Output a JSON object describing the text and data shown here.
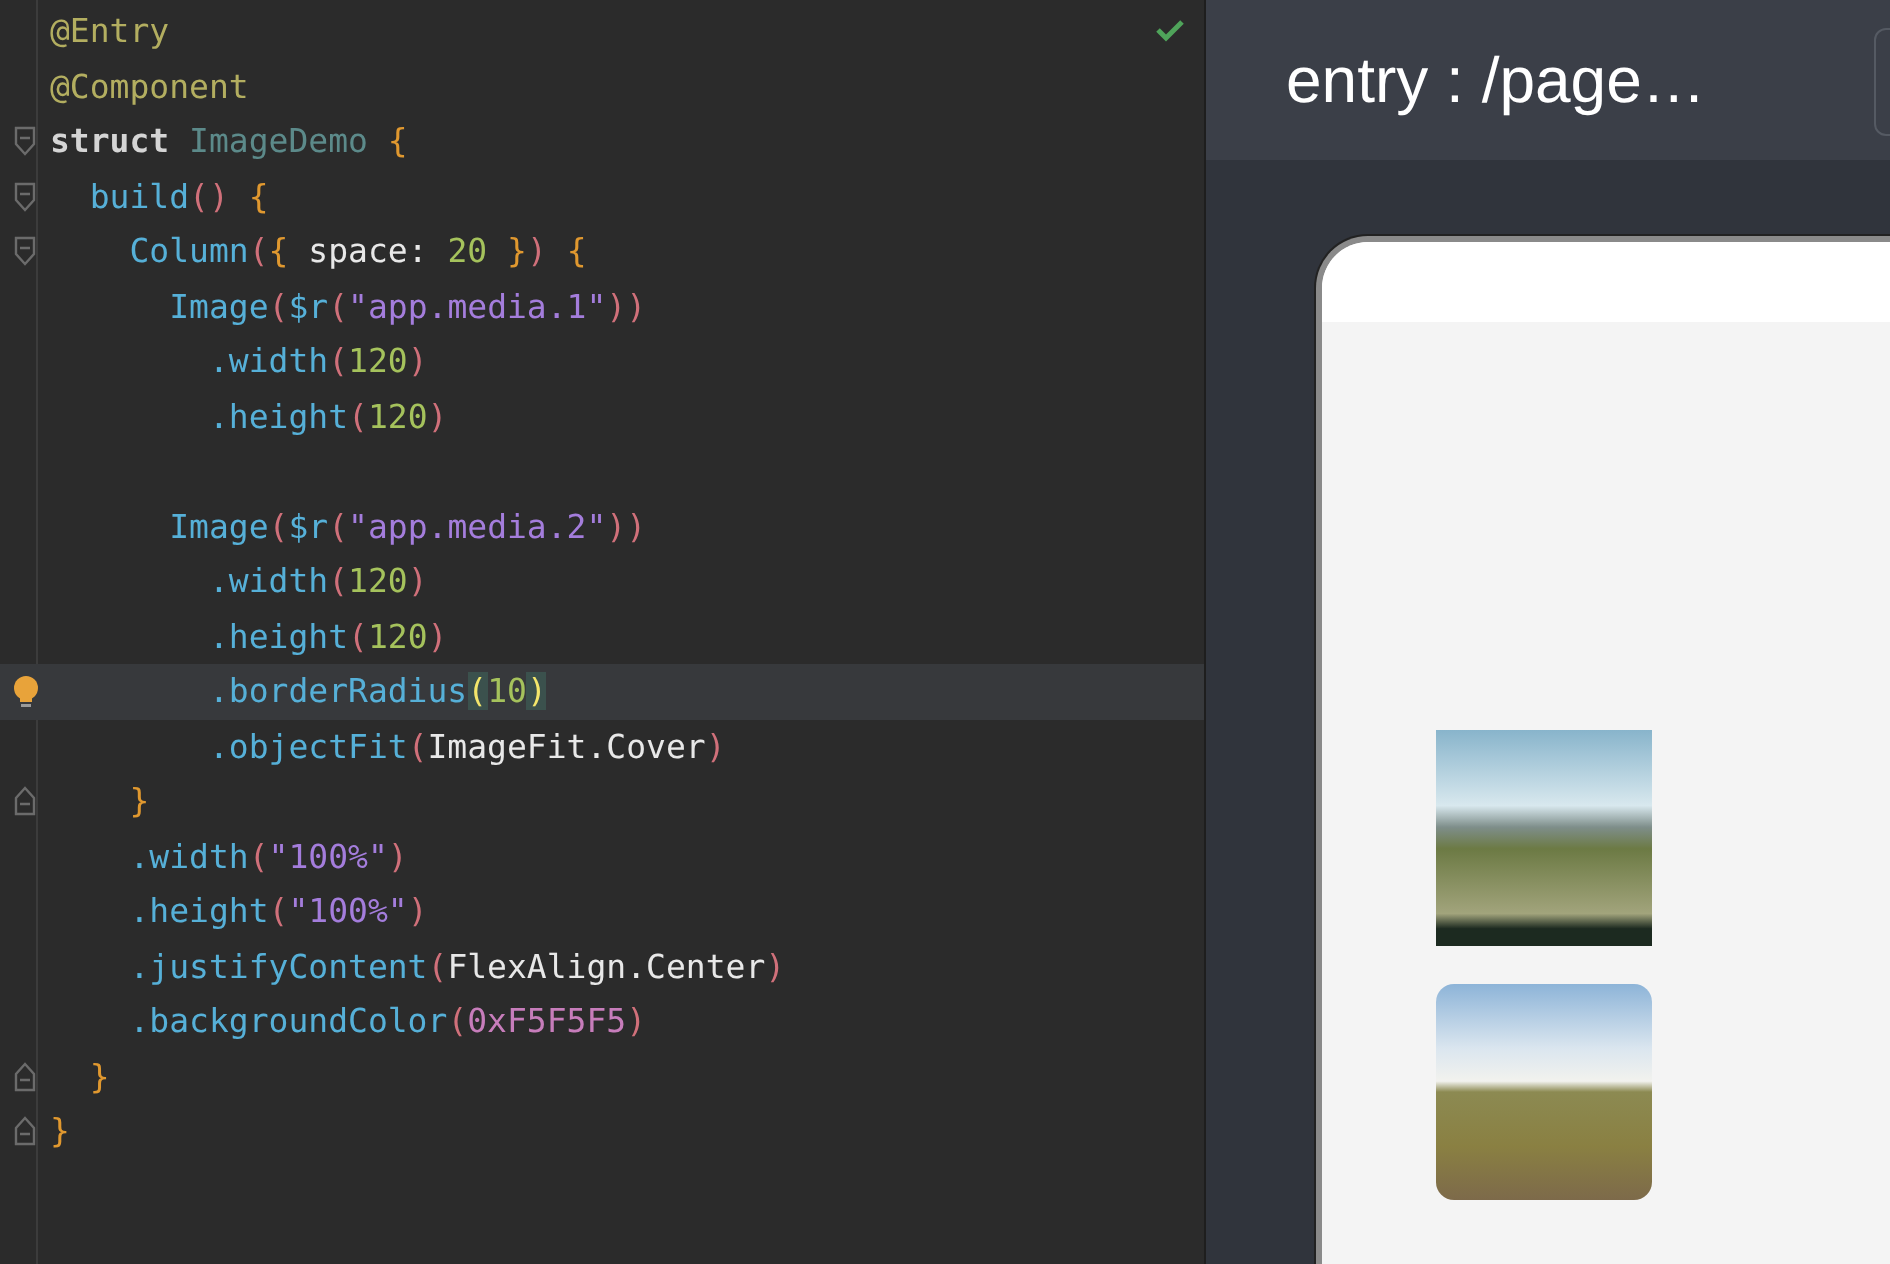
{
  "editor": {
    "status_ok": true,
    "lines": [
      {
        "current": false,
        "tokens": [
          {
            "text": "@Entry",
            "kind": "anno"
          }
        ]
      },
      {
        "current": false,
        "tokens": [
          {
            "text": "@Component",
            "kind": "anno"
          }
        ]
      },
      {
        "kind": "fold-start",
        "current": false,
        "tokens": [
          {
            "text": "struct",
            "kind": "kw"
          },
          {
            "text": " ImageDemo",
            "kind": "type"
          },
          {
            "text": " {",
            "kind": "brace"
          }
        ]
      },
      {
        "kind": "fold-start",
        "current": false,
        "tokens": [
          {
            "text": "  build",
            "kind": "fn"
          },
          {
            "text": "()",
            "kind": "paren"
          },
          {
            "text": " {",
            "kind": "brace"
          }
        ]
      },
      {
        "kind": "fold-start",
        "current": false,
        "tokens": [
          {
            "text": "    Column",
            "kind": "fn"
          },
          {
            "text": "(",
            "kind": "paren"
          },
          {
            "text": "{",
            "kind": "brace"
          },
          {
            "text": " space: ",
            "kind": "plain"
          },
          {
            "text": "20",
            "kind": "num"
          },
          {
            "text": " }",
            "kind": "brace"
          },
          {
            "text": ")",
            "kind": "paren"
          },
          {
            "text": " {",
            "kind": "brace"
          }
        ]
      },
      {
        "current": false,
        "tokens": [
          {
            "text": "      Image",
            "kind": "fn"
          },
          {
            "text": "(",
            "kind": "paren"
          },
          {
            "text": "$r",
            "kind": "fn"
          },
          {
            "text": "(",
            "kind": "paren"
          },
          {
            "text": "\"app.media.1\"",
            "kind": "str"
          },
          {
            "text": "))",
            "kind": "paren"
          }
        ]
      },
      {
        "current": false,
        "tokens": [
          {
            "text": "        .width",
            "kind": "fn"
          },
          {
            "text": "(",
            "kind": "paren"
          },
          {
            "text": "120",
            "kind": "num"
          },
          {
            "text": ")",
            "kind": "paren"
          }
        ]
      },
      {
        "current": false,
        "tokens": [
          {
            "text": "        .height",
            "kind": "fn"
          },
          {
            "text": "(",
            "kind": "paren"
          },
          {
            "text": "120",
            "kind": "num"
          },
          {
            "text": ")",
            "kind": "paren"
          }
        ]
      },
      {
        "current": false
      },
      {
        "current": false,
        "tokens": [
          {
            "text": "      Image",
            "kind": "fn"
          },
          {
            "text": "(",
            "kind": "paren"
          },
          {
            "text": "$r",
            "kind": "fn"
          },
          {
            "text": "(",
            "kind": "paren"
          },
          {
            "text": "\"app.media.2\"",
            "kind": "str"
          },
          {
            "text": "))",
            "kind": "paren"
          }
        ]
      },
      {
        "current": false,
        "tokens": [
          {
            "text": "        .width",
            "kind": "fn"
          },
          {
            "text": "(",
            "kind": "paren"
          },
          {
            "text": "120",
            "kind": "num"
          },
          {
            "text": ")",
            "kind": "paren"
          }
        ]
      },
      {
        "current": false,
        "tokens": [
          {
            "text": "        .height",
            "kind": "fn"
          },
          {
            "text": "(",
            "kind": "paren"
          },
          {
            "text": "120",
            "kind": "num"
          },
          {
            "text": ")",
            "kind": "paren"
          }
        ]
      },
      {
        "kind": "bulb",
        "current": true,
        "tokens": [
          {
            "text": "        .borderRadius",
            "kind": "fn"
          },
          {
            "text": "(",
            "kind": "match"
          },
          {
            "text": "10",
            "kind": "num"
          },
          {
            "text": ")",
            "kind": "match"
          }
        ]
      },
      {
        "current": false,
        "tokens": [
          {
            "text": "        .objectFit",
            "kind": "fn"
          },
          {
            "text": "(",
            "kind": "paren"
          },
          {
            "text": "ImageFit.Cover",
            "kind": "plain"
          },
          {
            "text": ")",
            "kind": "paren"
          }
        ]
      },
      {
        "kind": "fold-end",
        "current": false,
        "tokens": [
          {
            "text": "    }",
            "kind": "brace"
          }
        ]
      },
      {
        "current": false,
        "tokens": [
          {
            "text": "    .width",
            "kind": "fn"
          },
          {
            "text": "(",
            "kind": "paren"
          },
          {
            "text": "\"100%\"",
            "kind": "str"
          },
          {
            "text": ")",
            "kind": "paren"
          }
        ]
      },
      {
        "current": false,
        "tokens": [
          {
            "text": "    .height",
            "kind": "fn"
          },
          {
            "text": "(",
            "kind": "paren"
          },
          {
            "text": "\"100%\"",
            "kind": "str"
          },
          {
            "text": ")",
            "kind": "paren"
          }
        ]
      },
      {
        "current": false,
        "tokens": [
          {
            "text": "    .justifyContent",
            "kind": "fn"
          },
          {
            "text": "(",
            "kind": "paren"
          },
          {
            "text": "FlexAlign.Center",
            "kind": "plain"
          },
          {
            "text": ")",
            "kind": "paren"
          }
        ]
      },
      {
        "current": false,
        "tokens": [
          {
            "text": "    .backgroundColor",
            "kind": "fn"
          },
          {
            "text": "(",
            "kind": "paren"
          },
          {
            "text": "0xF5F5F5",
            "kind": "hex"
          },
          {
            "text": ")",
            "kind": "paren"
          }
        ]
      },
      {
        "kind": "fold-end",
        "current": false,
        "tokens": [
          {
            "text": "  }",
            "kind": "brace"
          }
        ]
      },
      {
        "kind": "fold-end",
        "current": false,
        "tokens": [
          {
            "text": "}",
            "kind": "brace"
          }
        ]
      }
    ]
  },
  "preview": {
    "title": "entry : /page…",
    "images": [
      {
        "rounded": false
      },
      {
        "rounded": true
      }
    ]
  }
}
